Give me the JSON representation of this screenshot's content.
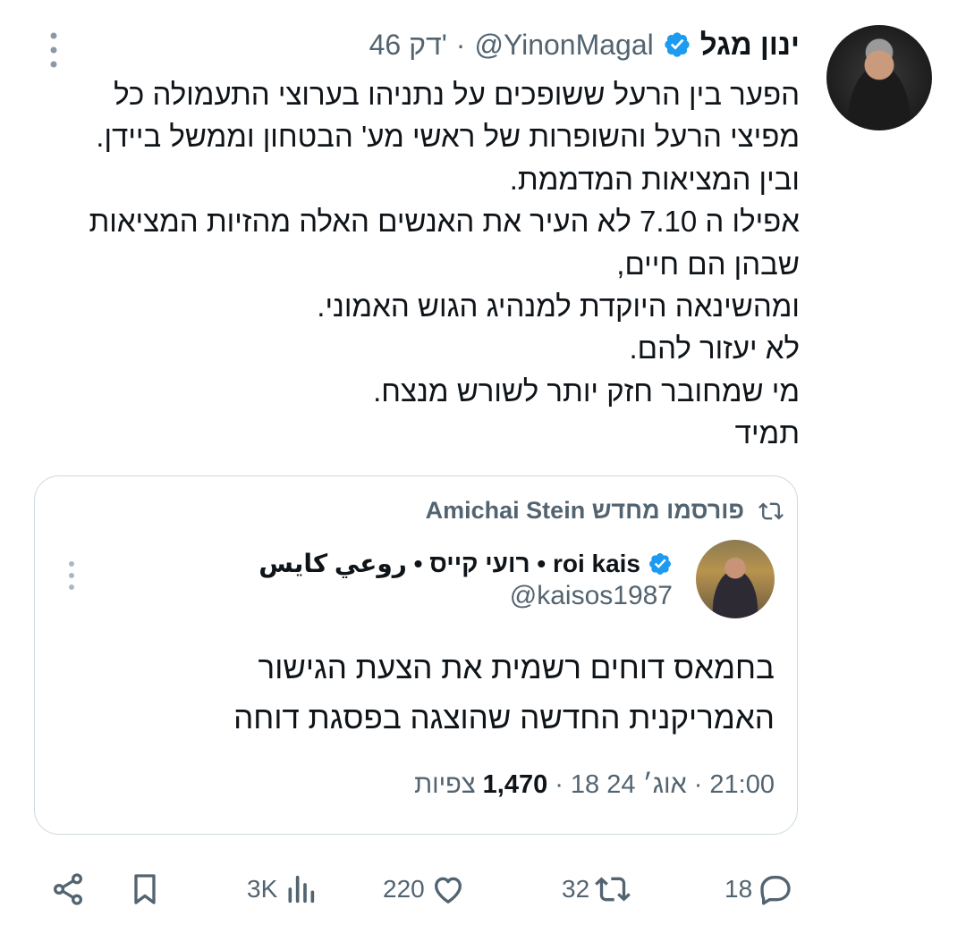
{
  "post": {
    "author_name": "ינון מגל",
    "handle": "@YinonMagal",
    "time": "46 דק'",
    "dot": "·",
    "lines": [
      "הפער בין הרעל ששופכים על נתניהו בערוצי התעמולה כל",
      "מפיצי הרעל והשופרות של ראשי מע' הבטחון וממשל ביידן.",
      "ובין המציאות המדממת.",
      "אפילו ה 7.10 לא העיר את האנשים האלה מהזיות המציאות",
      "שבהן הם חיים,",
      "ומהשינאה היוקדת למנהיג הגוש האמוני.",
      "לא יעזור להם.",
      "מי שמחובר חזק יותר לשורש מנצח.",
      "תמיד"
    ]
  },
  "quote": {
    "repost_label": "Amichai Stein פורסמו מחדש",
    "author_name": "roi kais • רועי קייס • روعي كايس",
    "handle": "@kaisos1987",
    "lines": [
      "בחמאס דוחים רשמית את הצעת הגישור",
      "האמריקנית החדשה שהוצגה בפסגת דוחה"
    ],
    "meta_time": "21:00",
    "meta_date": "18 אוג׳ 24",
    "meta_views": "1,470",
    "meta_views_label": "צפיות",
    "dot": "·"
  },
  "actions": {
    "replies": "18",
    "reposts": "32",
    "likes": "220",
    "views": "3K"
  },
  "colors": {
    "verified": "#1d9bf0",
    "muted": "#536471",
    "text": "#0f1419",
    "border": "#cfd9de"
  }
}
